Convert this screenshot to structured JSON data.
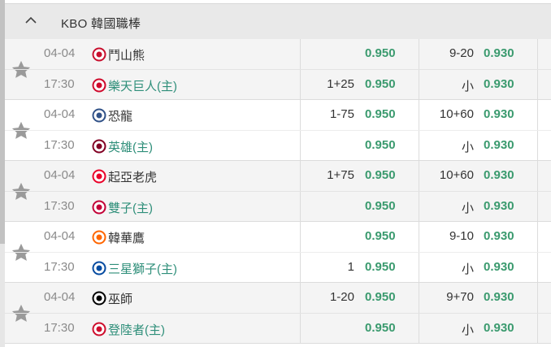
{
  "league": {
    "title": "KBO 韓國職棒",
    "collapse_icon": "chevron-up-icon"
  },
  "matches": [
    {
      "date": "04-04",
      "time": "17:30",
      "away": {
        "name": "鬥山熊",
        "logo_color": "#c8102e",
        "handicap": "",
        "odds": "0.950",
        "ou": "9-20",
        "ou_odds": "0.930"
      },
      "home": {
        "name": "樂天巨人(主)",
        "logo_color": "#cf0a2c",
        "handicap": "1+25",
        "odds": "0.950",
        "ou": "小",
        "ou_odds": "0.930"
      }
    },
    {
      "date": "04-04",
      "time": "17:30",
      "away": {
        "name": "恐龍",
        "logo_color": "#315288",
        "handicap": "1-75",
        "odds": "0.950",
        "ou": "10+60",
        "ou_odds": "0.930"
      },
      "home": {
        "name": "英雄(主)",
        "logo_color": "#820024",
        "handicap": "",
        "odds": "0.950",
        "ou": "小",
        "ou_odds": "0.930"
      }
    },
    {
      "date": "04-04",
      "time": "17:30",
      "away": {
        "name": "起亞老虎",
        "logo_color": "#ea0029",
        "handicap": "1+75",
        "odds": "0.950",
        "ou": "10+60",
        "ou_odds": "0.930"
      },
      "home": {
        "name": "雙子(主)",
        "logo_color": "#c30037",
        "handicap": "",
        "odds": "0.950",
        "ou": "小",
        "ou_odds": "0.930"
      }
    },
    {
      "date": "04-04",
      "time": "17:30",
      "away": {
        "name": "韓華鷹",
        "logo_color": "#ff6600",
        "handicap": "",
        "odds": "0.950",
        "ou": "9-10",
        "ou_odds": "0.930"
      },
      "home": {
        "name": "三星獅子(主)",
        "logo_color": "#074ca1",
        "handicap": "1",
        "odds": "0.950",
        "ou": "小",
        "ou_odds": "0.930"
      }
    },
    {
      "date": "04-04",
      "time": "17:30",
      "away": {
        "name": "巫師",
        "logo_color": "#000000",
        "handicap": "1-20",
        "odds": "0.950",
        "ou": "9+70",
        "ou_odds": "0.930"
      },
      "home": {
        "name": "登陸者(主)",
        "logo_color": "#ce0e2d",
        "handicap": "",
        "odds": "0.950",
        "ou": "小",
        "ou_odds": "0.930"
      }
    }
  ],
  "colors": {
    "odds": "#3a9a6e",
    "home_team": "#2f8f7a",
    "header_bg": "#e9e9e9",
    "star": "#9a9a9a"
  }
}
